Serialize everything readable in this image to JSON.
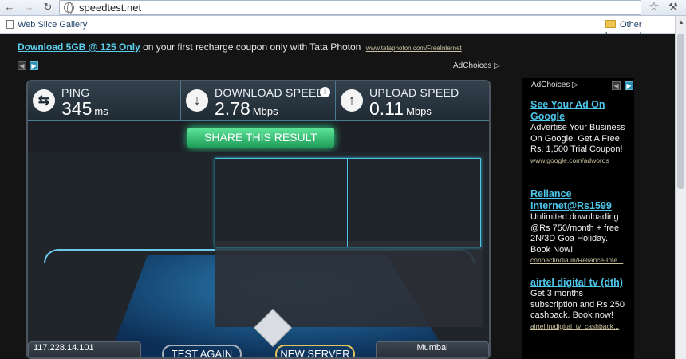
{
  "browser": {
    "url": "speedtest.net",
    "bookmarks": [
      "Web Slice Gallery"
    ],
    "other_bookmarks": "Other bookmarks",
    "back_icon": "back-arrow-icon",
    "forward_icon": "forward-arrow-icon",
    "reload_icon": "reload-icon"
  },
  "top_ad": {
    "link": "Download 5GB @ 125 Only",
    "text": " on your first recharge coupon only with Tata Photon",
    "url": "www.tataphoton.com/FreeInternet",
    "adchoices": "AdChoices"
  },
  "speedtest": {
    "ping": {
      "label": "PING",
      "value": "345",
      "unit": "ms"
    },
    "download": {
      "label": "DOWNLOAD SPEED",
      "value": "2.78",
      "unit": "Mbps"
    },
    "upload": {
      "label": "UPLOAD SPEED",
      "value": "0.11",
      "unit": "Mbps"
    },
    "share_button": "SHARE THIS RESULT",
    "ip": "117.228.14.101",
    "test_again": "TEST AGAIN",
    "new_server": "NEW SERVER",
    "server_city": "Mumbai"
  },
  "side_ads": {
    "adchoices": "AdChoices",
    "items": [
      {
        "title": "See Your Ad On Google",
        "body": "Advertise Your Business On Google. Get A Free Rs. 1,500 Trial Coupon!",
        "url": "www.google.com/adwords"
      },
      {
        "title": "Reliance Internet@Rs1599",
        "body": "Unlimited downloading @Rs 750/month + free 2N/3D Goa Holiday. Book Now!",
        "url": "connectindia.in/Reliance-Inte..."
      },
      {
        "title": "airtel digital tv (dth)",
        "body": "Get 3 months subscription and Rs 250 cashback. Book now!",
        "url": "airtel.in/digital_tv_cashback..."
      }
    ]
  }
}
